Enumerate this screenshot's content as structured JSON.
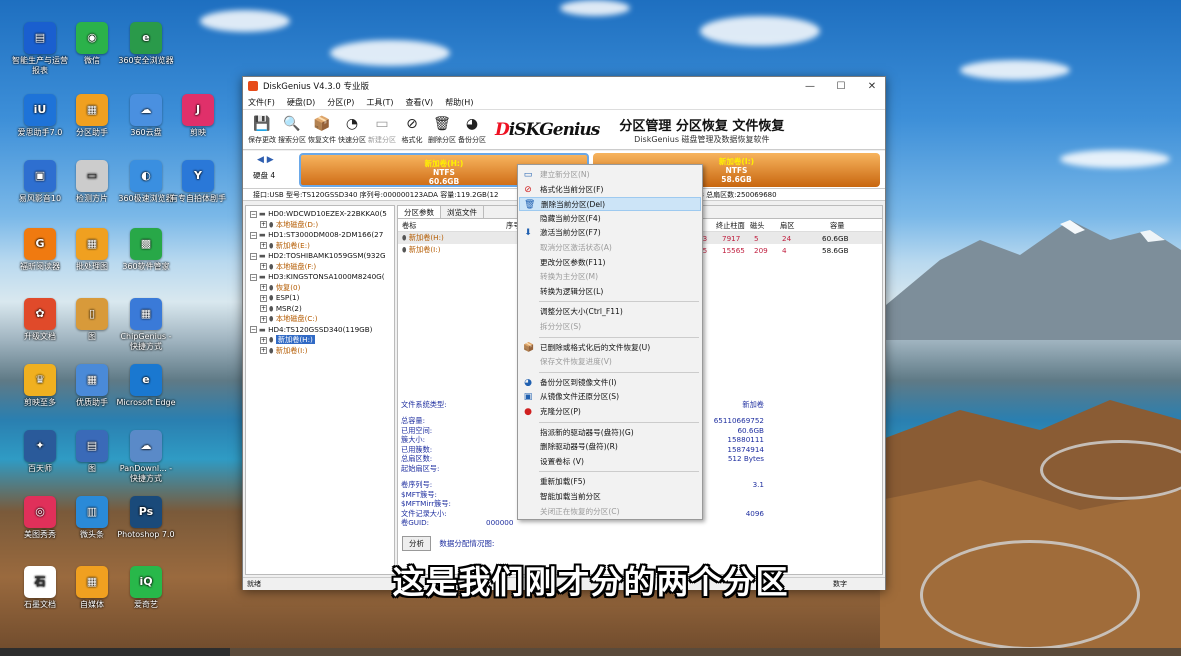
{
  "desktop_icons": [
    {
      "label": "智能生产与运营报表",
      "color": "#1a5fcf",
      "glyph": "▤",
      "icon": "report-icon"
    },
    {
      "label": "微信",
      "color": "#2bb24a",
      "glyph": "◉",
      "icon": "wechat-icon"
    },
    {
      "label": "360安全浏览器",
      "color": "#2a9a4a",
      "glyph": "e",
      "icon": "browser-360-icon"
    },
    {
      "label": "爱思助手7.0",
      "color": "#1e73d8",
      "glyph": "iU",
      "icon": "i4-icon"
    },
    {
      "label": "分区助手",
      "color": "#f0a020",
      "glyph": "▦",
      "icon": "folder-icon"
    },
    {
      "label": "360云盘",
      "color": "#4a90e0",
      "glyph": "☁",
      "icon": "cloud-360-icon"
    },
    {
      "label": "剪映",
      "color": "#e0306a",
      "glyph": "J",
      "icon": "jianying-icon"
    },
    {
      "label": "易风影音10",
      "color": "#2e6fd0",
      "glyph": "▣",
      "icon": "media-icon"
    },
    {
      "label": "检测方片",
      "color": "#cccccc",
      "glyph": "▭",
      "icon": "document-icon"
    },
    {
      "label": "360极速浏览器",
      "color": "#3a8fe0",
      "glyph": "◐",
      "icon": "browser-icon"
    },
    {
      "label": "有专自拍体剧手",
      "color": "#2a78d8",
      "glyph": "Y",
      "icon": "app-icon"
    },
    {
      "label": "福昕阅读器",
      "color": "#f07a10",
      "glyph": "G",
      "icon": "foxit-icon"
    },
    {
      "label": "批处理图",
      "color": "#f0a020",
      "glyph": "▦",
      "icon": "folder-icon"
    },
    {
      "label": "360软件管家",
      "color": "#28a848",
      "glyph": "▩",
      "icon": "software-manager-icon"
    },
    {
      "label": "升级文档",
      "color": "#e04a2a",
      "glyph": "✿",
      "icon": "pinwheel-icon"
    },
    {
      "label": "图",
      "color": "#d89a3a",
      "glyph": "▯",
      "icon": "file-icon"
    },
    {
      "label": "ChipGenius - 快捷方式",
      "color": "#3a7ad8",
      "glyph": "▦",
      "icon": "chipgenius-icon"
    },
    {
      "label": "剪映至多",
      "color": "#f0b020",
      "glyph": "♛",
      "icon": "tool-icon"
    },
    {
      "label": "优质助手",
      "color": "#4a8ad8",
      "glyph": "▦",
      "icon": "folder-icon"
    },
    {
      "label": "Microsoft Edge",
      "color": "#1a78d0",
      "glyph": "e",
      "icon": "edge-icon"
    },
    {
      "label": "百天师",
      "color": "#2a5a9a",
      "glyph": "✦",
      "icon": "app-icon"
    },
    {
      "label": "图",
      "color": "#3a6ab8",
      "glyph": "▤",
      "icon": "file-icon"
    },
    {
      "label": "PanDownl... - 快捷方式",
      "color": "#5a8ac8",
      "glyph": "☁",
      "icon": "pandownload-icon"
    },
    {
      "label": "美图秀秀",
      "color": "#e0305a",
      "glyph": "◎",
      "icon": "meitu-icon"
    },
    {
      "label": "微头条",
      "color": "#2a8ad8",
      "glyph": "▥",
      "icon": "folder-icon"
    },
    {
      "label": "Photoshop 7.0",
      "color": "#1a4a7a",
      "glyph": "Ps",
      "icon": "photoshop-icon"
    },
    {
      "label": "石墨文档",
      "color": "#ffffff",
      "glyph": "石",
      "icon": "shimo-icon"
    },
    {
      "label": "自媒体",
      "color": "#f0a020",
      "glyph": "▦",
      "icon": "folder-icon"
    },
    {
      "label": "爱奇艺",
      "color": "#28b84a",
      "glyph": "iQ",
      "icon": "iqiyi-icon"
    }
  ],
  "window": {
    "title": "DiskGenius V4.3.0 专业版",
    "minimize": "—",
    "maximize": "☐",
    "close": "✕",
    "menu": [
      "文件(F)",
      "硬盘(D)",
      "分区(P)",
      "工具(T)",
      "查看(V)",
      "帮助(H)"
    ],
    "toolbar": [
      {
        "label": "保存更改",
        "glyph": "💾",
        "icon": "save-icon",
        "enabled": true
      },
      {
        "label": "搜索分区",
        "glyph": "🔍",
        "icon": "search-partition-icon",
        "enabled": true
      },
      {
        "label": "恢复文件",
        "glyph": "📦",
        "icon": "recover-files-icon",
        "enabled": true
      },
      {
        "label": "快速分区",
        "glyph": "◔",
        "icon": "quick-partition-icon",
        "enabled": true
      },
      {
        "label": "新建分区",
        "glyph": "▭",
        "icon": "new-partition-icon",
        "enabled": false
      },
      {
        "label": "格式化",
        "glyph": "⊘",
        "icon": "format-icon",
        "enabled": true
      },
      {
        "label": "删除分区",
        "glyph": "🗑",
        "icon": "delete-partition-icon",
        "enabled": true
      },
      {
        "label": "备份分区",
        "glyph": "◕",
        "icon": "backup-partition-icon",
        "enabled": true
      }
    ],
    "logo": {
      "d": "D",
      "rest": "iSKGenius"
    },
    "slogan_main": "分区管理 分区恢复 文件恢复",
    "slogan_sub": "DiskGenius 磁盘管理及数据恢复软件"
  },
  "disk_map": {
    "nav": "◀ ▶",
    "disk_label": "硬盘 4",
    "partitions": [
      {
        "name": "新加卷(H:)",
        "fs": "NTFS",
        "size": "60.6GB"
      },
      {
        "name": "新加卷(I:)",
        "fs": "NTFS",
        "size": "58.6GB"
      }
    ],
    "info_line": "接口:USB  型号:TS120GSSD340  序列号:000000123ADA  容量:119.2GB(12"
  },
  "info_line_right": "63  总扇区数:250069680",
  "tree": [
    {
      "indent": 0,
      "text": "HD0:WDCWD10EZEX-22BKKA0(5",
      "kind": "disk"
    },
    {
      "indent": 1,
      "text": "本地磁盘(D:)",
      "kind": "part"
    },
    {
      "indent": 0,
      "text": "HD1:ST3000DM008-2DM166(27",
      "kind": "disk"
    },
    {
      "indent": 1,
      "text": "新加卷(E:)",
      "kind": "part"
    },
    {
      "indent": 0,
      "text": "HD2:TOSHIBAMK1059GSM(932G",
      "kind": "disk"
    },
    {
      "indent": 1,
      "text": "本地磁盘(F:)",
      "kind": "part"
    },
    {
      "indent": 0,
      "text": "HD3:KINGSTONSA1000M8240G(",
      "kind": "disk"
    },
    {
      "indent": 1,
      "text": "恢复(0)",
      "kind": "part"
    },
    {
      "indent": 1,
      "text": "ESP(1)",
      "kind": "sys"
    },
    {
      "indent": 1,
      "text": "MSR(2)",
      "kind": "sys"
    },
    {
      "indent": 1,
      "text": "本地磁盘(C:)",
      "kind": "part"
    },
    {
      "indent": 0,
      "text": "HD4:TS120GSSD340(119GB)",
      "kind": "disk"
    },
    {
      "indent": 1,
      "text": "新加卷(H:)",
      "kind": "selected"
    },
    {
      "indent": 1,
      "text": "新加卷(I:)",
      "kind": "part"
    }
  ],
  "tabs": [
    "分区参数",
    "浏览文件"
  ],
  "table": {
    "head_left": [
      "卷标",
      "序号"
    ],
    "head_right": [
      "终止柱面",
      "磁头",
      "扇区",
      "容量"
    ],
    "rows": [
      {
        "label": "新加卷(H:)",
        "prefix": "33",
        "end_cyl": "7917",
        "head": "5",
        "sector": "24",
        "cap": "60.6GB"
      },
      {
        "label": "新加卷(I:)",
        "prefix": "25",
        "end_cyl": "15565",
        "head": "209",
        "sector": "4",
        "cap": "58.6GB"
      }
    ]
  },
  "details": {
    "fs_type_label": "文件系统类型:",
    "fs_type_value": "新加卷",
    "labels": [
      "总容量:",
      "已用空间:",
      "簇大小:",
      "已用簇数:",
      "总扇区数:",
      "起始扇区号:"
    ],
    "values": [
      "65110669752",
      "60.6GB",
      "15880111",
      "15874914",
      "512 Bytes",
      ""
    ],
    "labels2": [
      "卷序列号:",
      "$MFT簇号:",
      "$MFTMirr簇号:",
      "文件记录大小:",
      "卷GUID:"
    ],
    "values2": [
      "3.1",
      "",
      "",
      "4096",
      ""
    ],
    "guid_prefix": "000000"
  },
  "analyze": {
    "button": "分析",
    "label": "数据分配情况图:"
  },
  "statusbar": "就绪",
  "statusbar_right": "数字",
  "context_menu": [
    {
      "label": "建立新分区(N)",
      "enabled": false,
      "glyph": "▭",
      "icon": "new-partition-icon"
    },
    {
      "label": "格式化当前分区(F)",
      "enabled": true,
      "glyph": "⊘",
      "icon": "format-icon"
    },
    {
      "label": "删除当前分区(Del)",
      "enabled": true,
      "glyph": "🗑",
      "icon": "delete-icon",
      "highlight": true
    },
    {
      "label": "隐藏当前分区(F4)",
      "enabled": true,
      "glyph": "",
      "icon": ""
    },
    {
      "label": "激活当前分区(F7)",
      "enabled": true,
      "glyph": "⬇",
      "icon": "activate-icon"
    },
    {
      "label": "取消分区激活状态(A)",
      "enabled": false,
      "glyph": "",
      "icon": ""
    },
    {
      "label": "更改分区参数(F11)",
      "enabled": true,
      "glyph": "",
      "icon": ""
    },
    {
      "label": "转换为主分区(M)",
      "enabled": false,
      "glyph": "",
      "icon": ""
    },
    {
      "label": "转换为逻辑分区(L)",
      "enabled": true,
      "glyph": "",
      "icon": "",
      "sep_after": true
    },
    {
      "label": "调整分区大小(Ctrl_F11)",
      "enabled": true,
      "glyph": "",
      "icon": ""
    },
    {
      "label": "拆分分区(S)",
      "enabled": false,
      "glyph": "",
      "icon": "",
      "sep_after": true
    },
    {
      "label": "已删除或格式化后的文件恢复(U)",
      "enabled": true,
      "glyph": "📦",
      "icon": "recover-icon"
    },
    {
      "label": "保存文件恢复进度(V)",
      "enabled": false,
      "glyph": "",
      "icon": "",
      "sep_after": true
    },
    {
      "label": "备份分区到镜像文件(I)",
      "enabled": true,
      "glyph": "◕",
      "icon": "backup-icon"
    },
    {
      "label": "从镜像文件还原分区(S)",
      "enabled": true,
      "glyph": "▣",
      "icon": "restore-icon"
    },
    {
      "label": "克隆分区(P)",
      "enabled": true,
      "glyph": "●",
      "icon": "clone-icon",
      "sep_after": true
    },
    {
      "label": "指派新的驱动器号(盘符)(G)",
      "enabled": true,
      "glyph": "",
      "icon": ""
    },
    {
      "label": "删除驱动器号(盘符)(R)",
      "enabled": true,
      "glyph": "",
      "icon": ""
    },
    {
      "label": "设置卷标 (V)",
      "enabled": true,
      "glyph": "",
      "icon": "",
      "sep_after": true
    },
    {
      "label": "重新加载(F5)",
      "enabled": true,
      "glyph": "",
      "icon": ""
    },
    {
      "label": "智能加载当前分区",
      "enabled": true,
      "glyph": "",
      "icon": ""
    },
    {
      "label": "关闭正在恢复的分区(C)",
      "enabled": false,
      "glyph": "",
      "icon": ""
    }
  ],
  "subtitle": "这是我们刚才分的两个分区"
}
